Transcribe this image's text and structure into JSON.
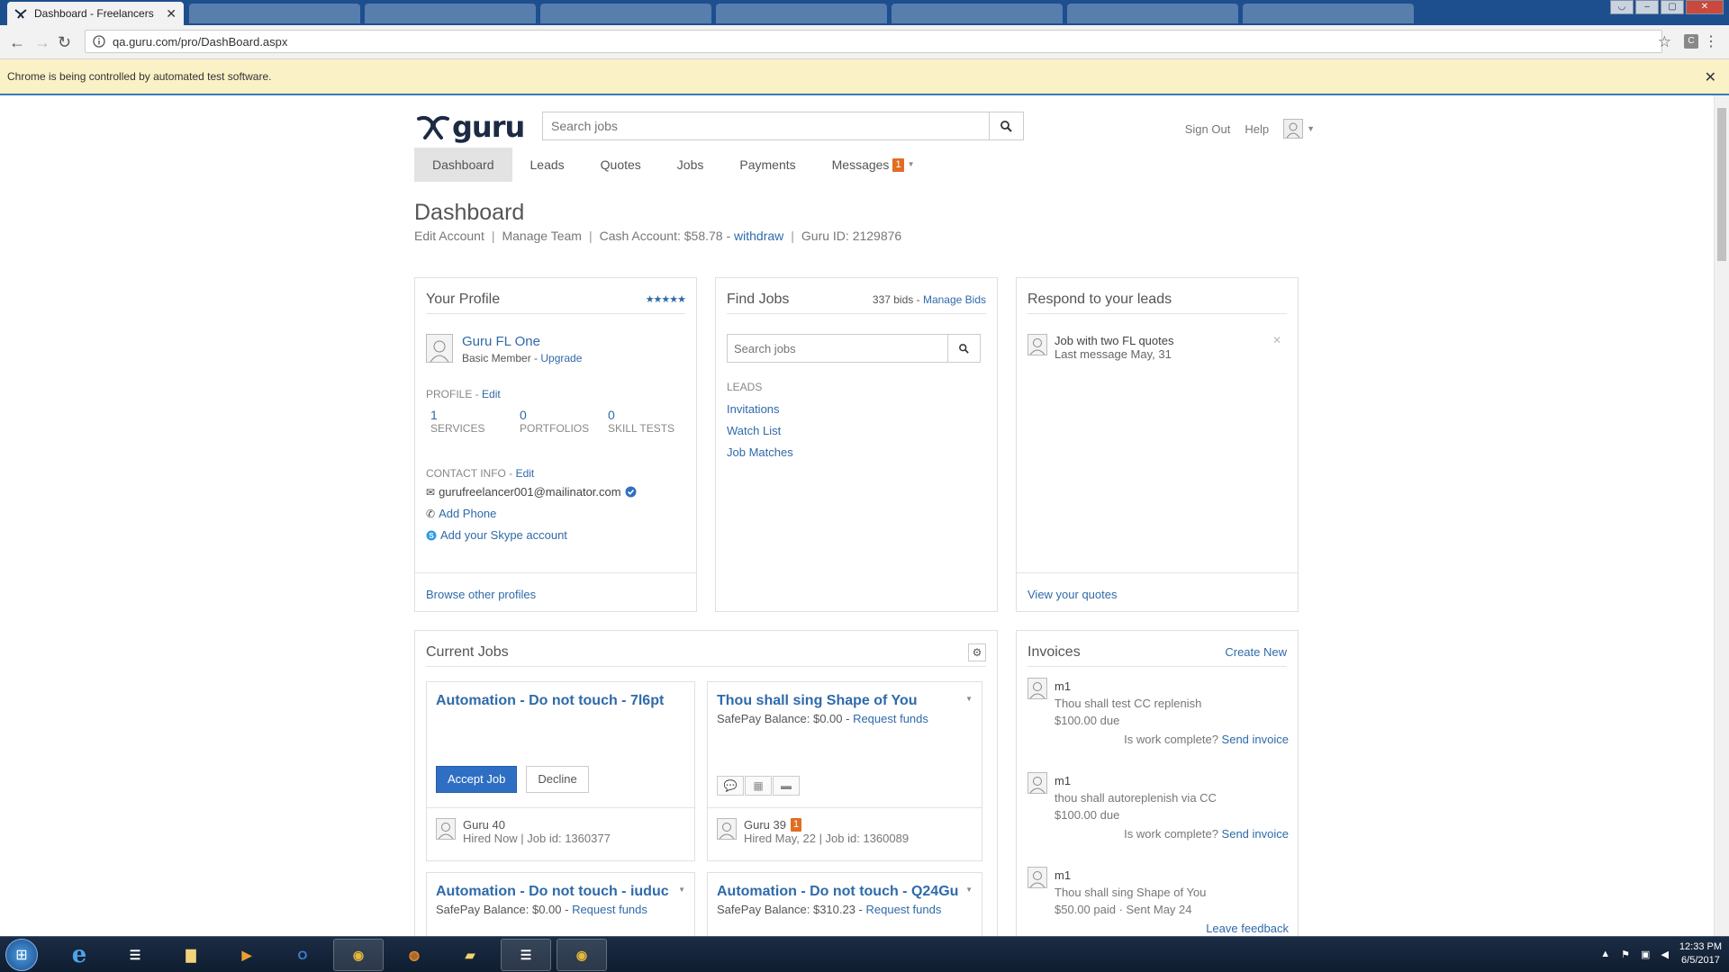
{
  "browser": {
    "active_tab_title": "Dashboard - Freelancers",
    "url": "qa.guru.com/pro/DashBoard.aspx",
    "infobar_text": "Chrome is being controlled by automated test software.",
    "extension_label": "C"
  },
  "header": {
    "logo_text": "guru",
    "search_placeholder": "Search jobs",
    "sign_out": "Sign Out",
    "help": "Help"
  },
  "nav": {
    "dashboard": "Dashboard",
    "leads": "Leads",
    "quotes": "Quotes",
    "jobs": "Jobs",
    "payments": "Payments",
    "messages": "Messages",
    "messages_count": "1"
  },
  "page": {
    "title": "Dashboard",
    "edit_account": "Edit Account",
    "manage_team": "Manage Team",
    "cash_account": "Cash Account: $58.78 -",
    "withdraw": "withdraw",
    "guru_id": "Guru ID: 2129876",
    "separator": "|"
  },
  "profile": {
    "heading": "Your Profile",
    "stars": "★★★★★",
    "name": "Guru FL One",
    "membership": "Basic Member -",
    "upgrade": "Upgrade",
    "profile_label": "PROFILE -",
    "edit": "Edit",
    "services_count": "1",
    "services_label": "SERVICES",
    "portfolios_count": "0",
    "portfolios_label": "PORTFOLIOS",
    "skill_tests_count": "0",
    "skill_tests_label": "SKILL TESTS",
    "contact_label": "CONTACT INFO -",
    "contact_edit": "Edit",
    "email": "gurufreelancer001@mailinator.com",
    "add_phone": "Add Phone",
    "add_skype": "Add your Skype account",
    "browse_profiles": "Browse other profiles"
  },
  "find_jobs": {
    "heading": "Find Jobs",
    "bids": "337 bids -",
    "manage_bids": "Manage Bids",
    "search_placeholder": "Search jobs",
    "leads_label": "LEADS",
    "invitations": "Invitations",
    "watch_list": "Watch List",
    "job_matches": "Job Matches"
  },
  "leads": {
    "heading": "Respond to your leads",
    "item_title": "Job with two FL quotes",
    "item_sub": "Last message May, 31",
    "view_quotes": "View your quotes"
  },
  "current_jobs": {
    "heading": "Current Jobs",
    "jobs": [
      {
        "title": "Automation - Do not touch - 7l6pt",
        "accept": "Accept Job",
        "decline": "Decline",
        "person": "Guru 40",
        "meta": "Hired Now | Job id: 1360377"
      },
      {
        "title": "Thou shall sing Shape of You",
        "balance": "SafePay Balance: $0.00 -",
        "request": "Request funds",
        "person": "Guru 39",
        "person_badge": "1",
        "meta": "Hired May, 22 | Job id: 1360089"
      },
      {
        "title": "Automation - Do not touch - iuduc",
        "balance": "SafePay Balance: $0.00 -",
        "request": "Request funds"
      },
      {
        "title": "Automation - Do not touch - Q24Gu",
        "balance": "SafePay Balance: $310.23 -",
        "request": "Request funds"
      }
    ]
  },
  "invoices": {
    "heading": "Invoices",
    "create_new": "Create New",
    "items": [
      {
        "name": "m1",
        "desc": "Thou shall test CC replenish",
        "amount": "$100.00 due",
        "prompt": "Is work complete?",
        "action": "Send invoice"
      },
      {
        "name": "m1",
        "desc": "thou shall autoreplenish via CC",
        "amount": "$100.00 due",
        "prompt": "Is work complete?",
        "action": "Send invoice"
      },
      {
        "name": "m1",
        "desc": "Thou shall sing Shape of You",
        "amount": "$50.00 paid · Sent May 24",
        "action": "Leave feedback"
      }
    ]
  },
  "taskbar": {
    "time": "12:33 PM",
    "date": "6/5/2017"
  }
}
